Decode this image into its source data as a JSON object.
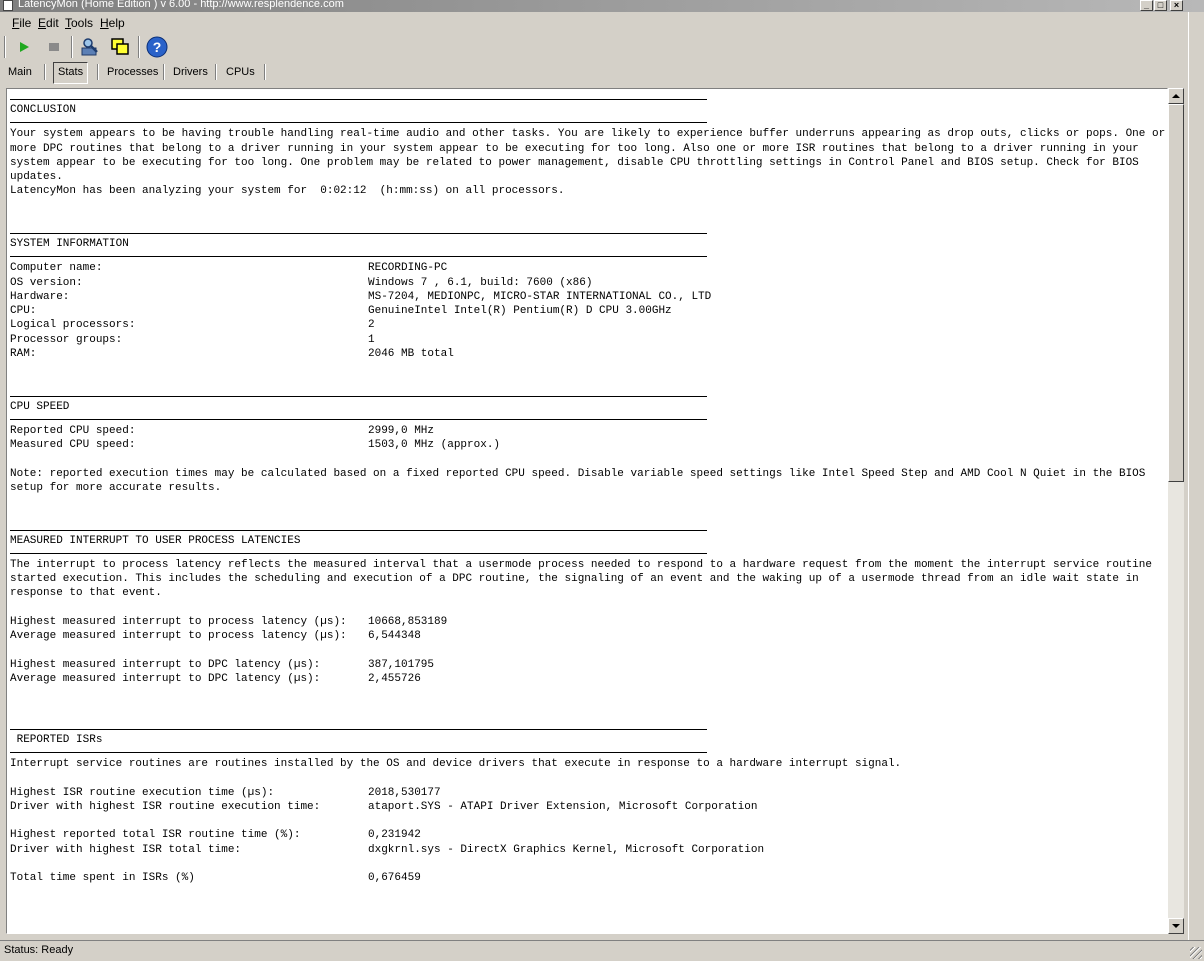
{
  "window": {
    "title": "LatencyMon  (Home Edition )  v 6.00 - http://www.resplendence.com"
  },
  "menu": [
    "File",
    "Edit",
    "Tools",
    "Help"
  ],
  "toolbar": {
    "icons": [
      "play-icon",
      "stop-icon",
      "analyze-icon",
      "windows-icon",
      "help-icon"
    ]
  },
  "tabs": [
    {
      "label": "Main",
      "active": false
    },
    {
      "label": "Stats",
      "active": true
    },
    {
      "label": "Processes",
      "active": false
    },
    {
      "label": "Drivers",
      "active": false
    },
    {
      "label": "CPUs",
      "active": false
    }
  ],
  "report": {
    "conclusion": {
      "heading": "CONCLUSION",
      "text": "Your system appears to be having trouble handling real-time audio and other tasks. You are likely to experience buffer underruns appearing as drop outs, clicks or pops. One or more DPC routines that belong to a driver running in your system appear to be executing for too long. Also one or more ISR routines that belong to a driver running in your system appear to be executing for too long. One problem may be related to power management, disable CPU throttling settings in Control Panel and BIOS setup. Check for BIOS updates.",
      "analyzing": "LatencyMon has been analyzing your system for  0:02:12  (h:mm:ss) on all processors."
    },
    "system_information": {
      "heading": "SYSTEM INFORMATION",
      "rows": [
        {
          "k": "Computer name:",
          "v": "RECORDING-PC"
        },
        {
          "k": "OS version:",
          "v": "Windows 7 , 6.1, build: 7600 (x86)"
        },
        {
          "k": "Hardware:",
          "v": "MS-7204, MEDIONPC, MICRO-STAR INTERNATIONAL CO., LTD"
        },
        {
          "k": "CPU:",
          "v": "GenuineIntel Intel(R) Pentium(R) D CPU 3.00GHz"
        },
        {
          "k": "Logical processors:",
          "v": "2"
        },
        {
          "k": "Processor groups:",
          "v": "1"
        },
        {
          "k": "RAM:",
          "v": "2046 MB total"
        }
      ]
    },
    "cpu_speed": {
      "heading": "CPU SPEED",
      "rows": [
        {
          "k": "Reported CPU speed:",
          "v": "2999,0 MHz"
        },
        {
          "k": "Measured CPU speed:",
          "v": "1503,0 MHz (approx.)"
        }
      ],
      "note": "Note: reported execution times may be calculated based on a fixed reported CPU speed. Disable variable speed settings like Intel Speed Step and AMD Cool N Quiet in the BIOS setup for more accurate results."
    },
    "latencies": {
      "heading": "MEASURED INTERRUPT TO USER PROCESS LATENCIES",
      "text": "The interrupt to process latency reflects the measured interval that a usermode process needed to respond to a hardware request from the moment the interrupt service routine started execution. This includes the scheduling and execution of a DPC routine, the signaling of an event and the waking up of a usermode thread from an idle wait state in response to that event.",
      "rows1": [
        {
          "k": "Highest measured interrupt to process latency (µs):",
          "v": "10668,853189"
        },
        {
          "k": "Average measured interrupt to process latency (µs):",
          "v": "6,544348"
        }
      ],
      "rows2": [
        {
          "k": "Highest measured interrupt to DPC latency (µs):",
          "v": "387,101795"
        },
        {
          "k": "Average measured interrupt to DPC latency (µs):",
          "v": "2,455726"
        }
      ]
    },
    "isrs": {
      "heading": " REPORTED ISRs",
      "text": "Interrupt service routines are routines installed by the OS and device drivers that execute in response to a hardware interrupt signal.",
      "rows1": [
        {
          "k": "Highest ISR routine execution time (µs):",
          "v": "2018,530177"
        },
        {
          "k": "Driver with highest ISR routine execution time:",
          "v": "ataport.SYS - ATAPI Driver Extension, Microsoft Corporation"
        }
      ],
      "rows2": [
        {
          "k": "Highest reported total ISR routine time (%):",
          "v": "0,231942"
        },
        {
          "k": "Driver with highest ISR total time:",
          "v": "dxgkrnl.sys - DirectX Graphics Kernel, Microsoft Corporation"
        }
      ],
      "rows3": [
        {
          "k": "Total time spent in ISRs (%)",
          "v": "0,676459"
        }
      ]
    }
  },
  "status": {
    "text": "Status: Ready"
  }
}
